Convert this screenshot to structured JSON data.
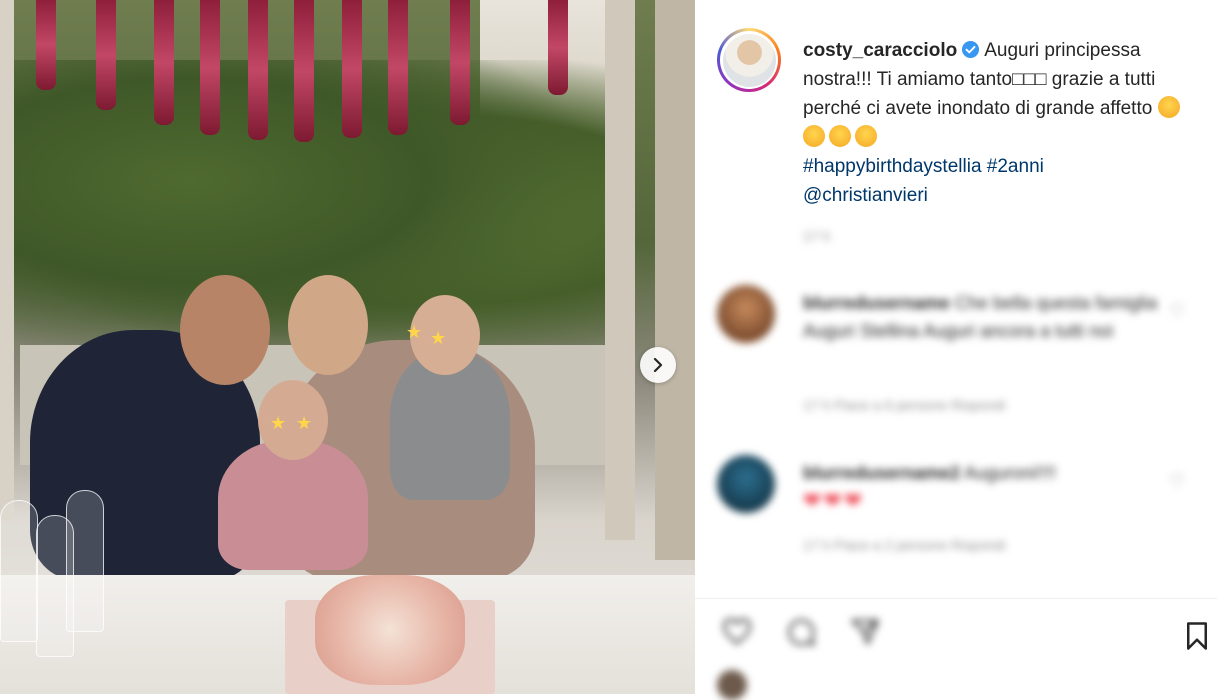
{
  "post": {
    "username": "costy_caracciolo",
    "caption_main": "Auguri principessa nostra!!! Ti amiamo tanto□□□ grazie a tutti perché ci avete inondato di grande affetto",
    "hashtags": [
      "#happybirthdaystellia",
      "#2anni"
    ],
    "mention": "@christianvieri",
    "time_ago": "17 h"
  },
  "comments": [
    {
      "username": "blurredusername",
      "text": "Che bella questa famiglia Auguri Stellina Auguri ancora a tutti noi",
      "meta": "17 h   Piace a 6 persone   Rispondi"
    },
    {
      "username": "blurredusername2",
      "text": "Auguroni!!!!",
      "hearts": "❤❤❤",
      "meta": "17 h   Piace a 2 persone   Rispondi"
    }
  ],
  "icons": {
    "next": "chevron-right-icon",
    "verified": "verified-badge-icon",
    "like": "heart-icon",
    "comment": "comment-icon",
    "share": "share-icon",
    "save": "bookmark-icon"
  },
  "colors": {
    "link": "#00376b",
    "verified": "#3897f0",
    "text": "#262626",
    "muted": "#8e8e8e"
  }
}
